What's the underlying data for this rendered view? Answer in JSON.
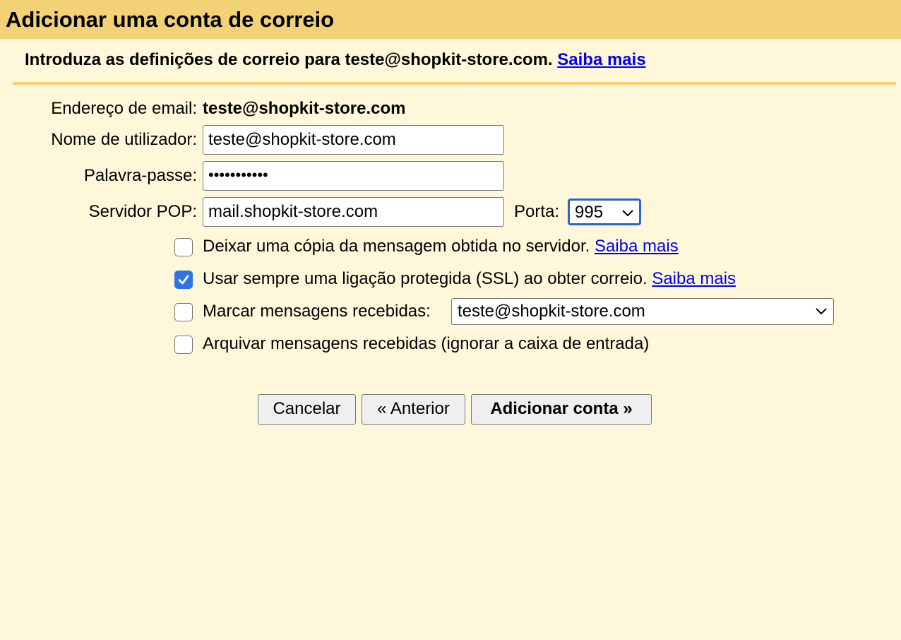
{
  "dialog": {
    "title": "Adicionar uma conta de correio",
    "intro_text": "Introduza as definições de correio para teste@shopkit-store.com.",
    "intro_link": "Saiba mais"
  },
  "form": {
    "email_label": "Endereço de email:",
    "email_value": "teste@shopkit-store.com",
    "username_label": "Nome de utilizador:",
    "username_value": "teste@shopkit-store.com",
    "password_label": "Palavra-passe:",
    "password_value": "•••••••••••",
    "pop_server_label": "Servidor POP:",
    "pop_server_value": "mail.shopkit-store.com",
    "port_label": "Porta:",
    "port_value": "995"
  },
  "options": {
    "leave_copy": {
      "label": "Deixar uma cópia da mensagem obtida no servidor.",
      "link": "Saiba mais",
      "checked": false
    },
    "use_ssl": {
      "label": "Usar sempre uma ligação protegida (SSL) ao obter correio.",
      "link": "Saiba mais",
      "checked": true
    },
    "label_incoming": {
      "label": "Marcar mensagens recebidas:",
      "select_value": "teste@shopkit-store.com",
      "checked": false
    },
    "archive_incoming": {
      "label": "Arquivar mensagens recebidas (ignorar a caixa de entrada)",
      "checked": false
    }
  },
  "buttons": {
    "cancel": "Cancelar",
    "previous": "« Anterior",
    "add_account": "Adicionar conta »"
  },
  "colors": {
    "title_bar": "#f3d277",
    "background": "#fff7d9",
    "link": "#0000ee",
    "checkbox_checked": "#2f73e8",
    "focus_ring": "#2a62d9"
  }
}
